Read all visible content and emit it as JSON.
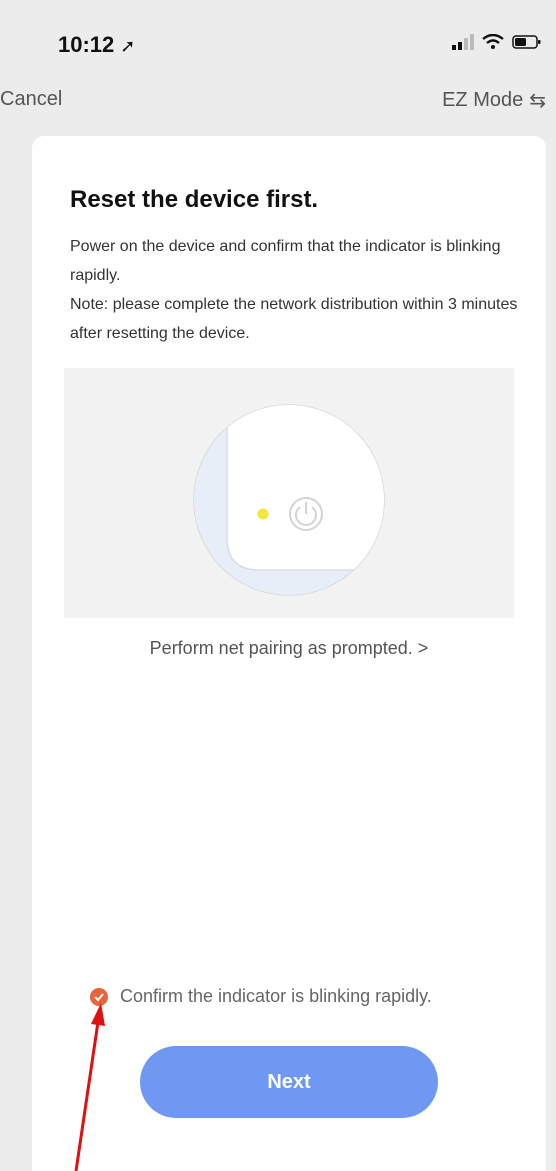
{
  "status_bar": {
    "time": "10:12"
  },
  "nav": {
    "cancel_label": "Cancel",
    "mode_label": "EZ Mode"
  },
  "content": {
    "title": "Reset the device first.",
    "description_line1": "Power on the device and confirm that the indicator is blinking rapidly.",
    "description_line2": "Note: please complete the network distribution within 3 minutes after resetting the device.",
    "pairing_link": "Perform net pairing as prompted. >",
    "confirm_label": "Confirm the indicator is blinking rapidly.",
    "next_label": "Next"
  },
  "colors": {
    "accent_button": "#6f98f2",
    "check_color": "#e8643c",
    "indicator_light": "#f5e63b",
    "annotation_arrow": "#e01010"
  }
}
